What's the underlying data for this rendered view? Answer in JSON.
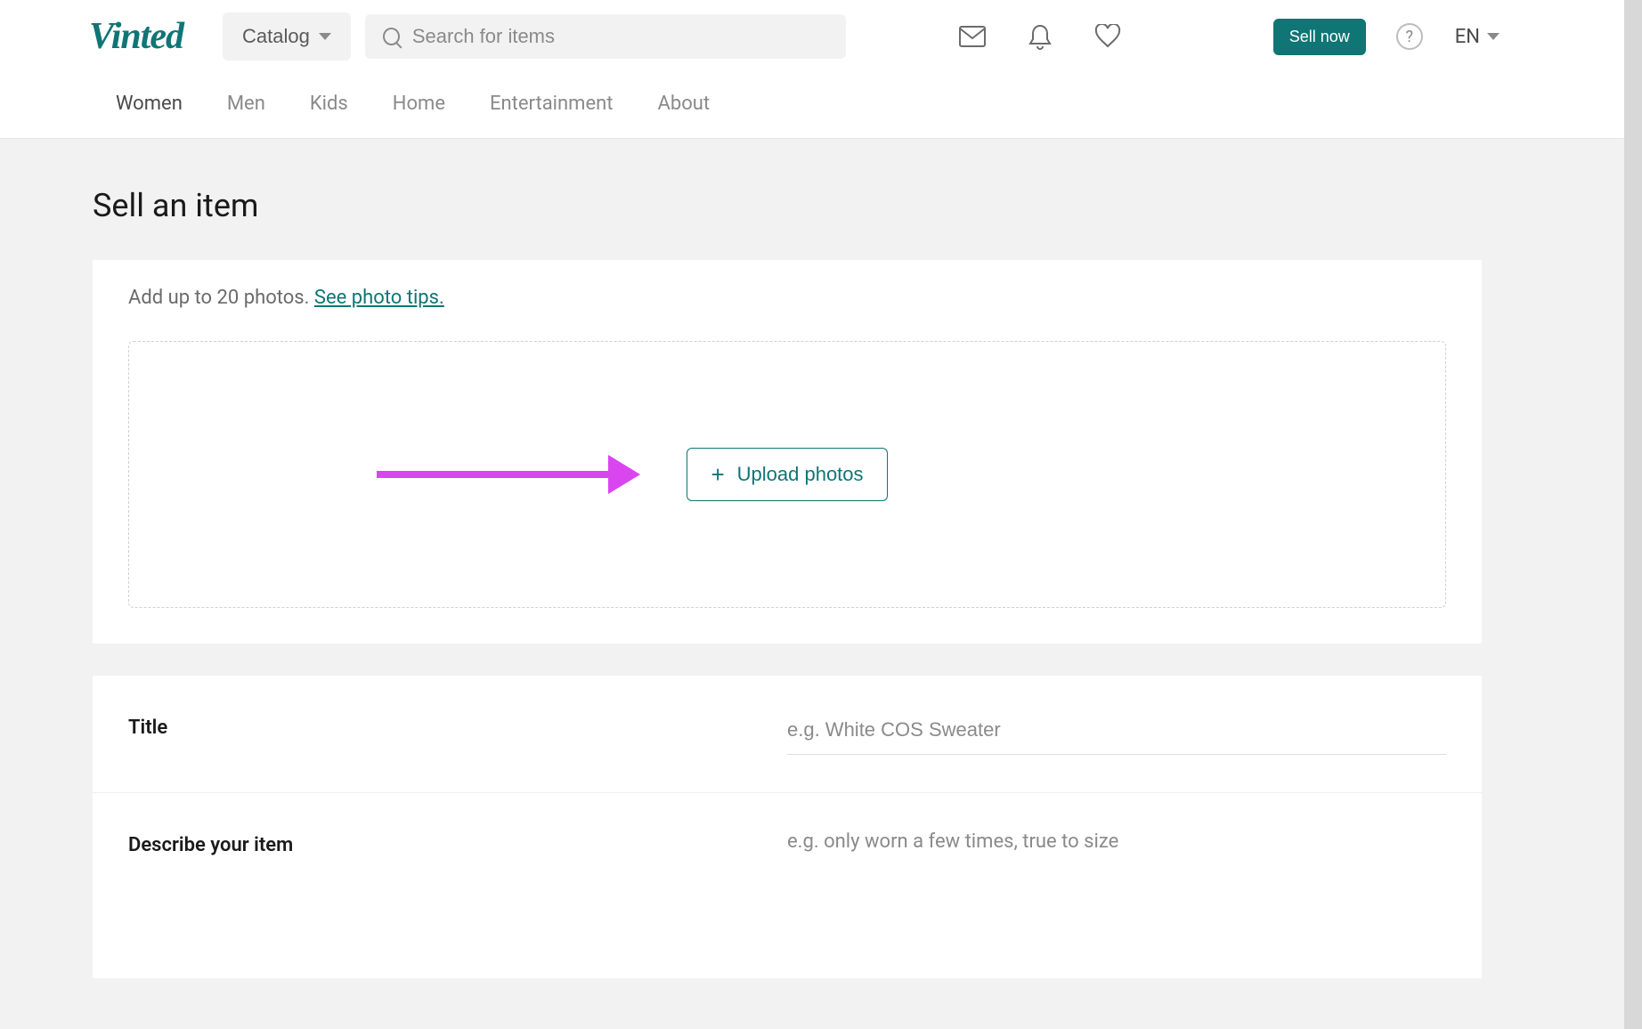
{
  "header": {
    "logo": "Vinted",
    "catalog_label": "Catalog",
    "search_placeholder": "Search for items",
    "sell_label": "Sell now",
    "help_glyph": "?",
    "lang_label": "EN"
  },
  "nav": {
    "items": [
      "Women",
      "Men",
      "Kids",
      "Home",
      "Entertainment",
      "About"
    ]
  },
  "page": {
    "title": "Sell an item"
  },
  "photos": {
    "hint_text": "Add up to 20 photos. ",
    "hint_link": "See photo tips.",
    "upload_label": "Upload photos"
  },
  "form": {
    "title_label": "Title",
    "title_placeholder": "e.g. White COS Sweater",
    "describe_label": "Describe your item",
    "describe_placeholder": "e.g. only worn a few times, true to size"
  }
}
